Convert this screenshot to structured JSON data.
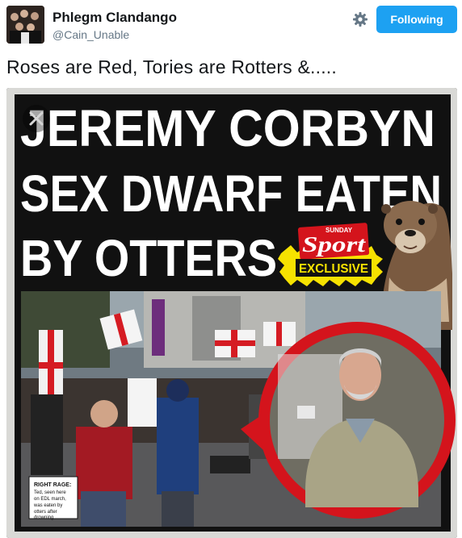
{
  "account": {
    "display_name": "Phlegm Clandango",
    "handle": "@Cain_Unable"
  },
  "actions": {
    "follow_label": "Following",
    "settings_icon": "gear-icon",
    "close_icon": "close-icon"
  },
  "tweet": {
    "text": "Roses are Red, Tories are Rotters &....."
  },
  "newspaper": {
    "headline_line1": "JEREMY CORBYN",
    "headline_line2": "SEX DWARF EATEN",
    "headline_line3": "BY OTTERS",
    "badge_top": "SUNDAY",
    "badge_brand": "Sport",
    "badge_exclusive": "EXCLUSIVE",
    "caption_title": "RIGHT RAGE:",
    "caption_lines": [
      "Ted, seen here",
      "on EDL march,",
      "was eaten by",
      "otters after",
      "drowning"
    ]
  },
  "colors": {
    "accent": "#1da1f2",
    "headline_bg": "#111111",
    "brand_red": "#d4141c",
    "badge_yellow": "#f6e200"
  }
}
